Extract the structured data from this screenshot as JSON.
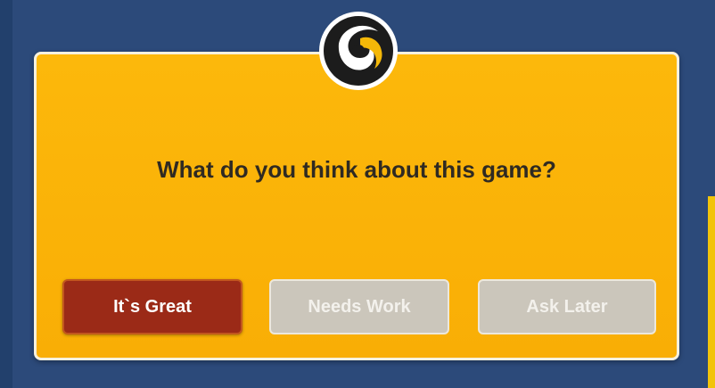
{
  "dialog": {
    "question": "What do you think about this game?",
    "logo_icon": "swirl-logo-icon"
  },
  "buttons": {
    "great_label": "It`s Great",
    "needs_work_label": "Needs Work",
    "ask_later_label": "Ask Later"
  },
  "colors": {
    "background": "#2c4a7a",
    "dialog": "#fcb80b",
    "primary_button": "#9b2a17",
    "secondary_button": "#cbc6bb"
  }
}
